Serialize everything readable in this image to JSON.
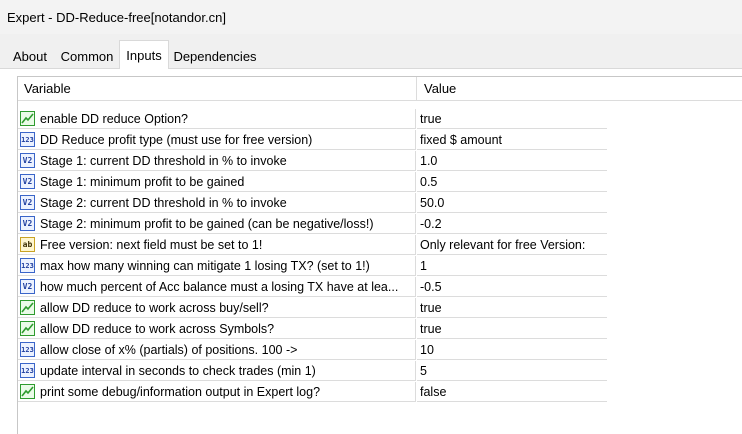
{
  "window": {
    "title": "Expert - DD-Reduce-free[notandor.cn]"
  },
  "tabs": [
    {
      "label": "About"
    },
    {
      "label": "Common"
    },
    {
      "label": "Inputs"
    },
    {
      "label": "Dependencies"
    }
  ],
  "table": {
    "headers": {
      "variable": "Variable",
      "value": "Value"
    },
    "rows": [
      {
        "type": "bool",
        "icon": "boolean-icon",
        "name": "enable DD reduce Option?",
        "value": "true"
      },
      {
        "type": "int",
        "icon": "integer-icon",
        "name": "DD Reduce profit type (must use for free version)",
        "value": "fixed $ amount"
      },
      {
        "type": "double",
        "icon": "double-icon",
        "name": "Stage 1: current DD threshold in % to invoke",
        "value": "1.0"
      },
      {
        "type": "double",
        "icon": "double-icon",
        "name": "Stage 1: minimum profit to be gained",
        "value": "0.5"
      },
      {
        "type": "double",
        "icon": "double-icon",
        "name": "Stage 2: current DD threshold in % to invoke",
        "value": "50.0"
      },
      {
        "type": "double",
        "icon": "double-icon",
        "name": "Stage 2: minimum profit to be gained (can be negative/loss!)",
        "value": "-0.2"
      },
      {
        "type": "string",
        "icon": "string-icon",
        "name": "Free version: next field must be set to 1!",
        "value": "Only relevant for free Version:"
      },
      {
        "type": "int",
        "icon": "integer-icon",
        "name": "max how many winning can mitigate 1 losing TX? (set to 1!)",
        "value": "1"
      },
      {
        "type": "double",
        "icon": "double-icon",
        "name": "how much percent of Acc balance must a losing TX have at lea...",
        "value": "-0.5"
      },
      {
        "type": "bool",
        "icon": "boolean-icon",
        "name": "allow DD reduce to work across buy/sell?",
        "value": "true"
      },
      {
        "type": "bool",
        "icon": "boolean-icon",
        "name": "allow DD reduce to work across Symbols?",
        "value": "true"
      },
      {
        "type": "int",
        "icon": "integer-icon",
        "name": "allow close of x% (partials) of positions. 100 ->",
        "value": "10"
      },
      {
        "type": "int",
        "icon": "integer-icon",
        "name": "update interval in seconds to check trades (min 1)",
        "value": "5"
      },
      {
        "type": "bool",
        "icon": "boolean-icon",
        "name": "print some debug/information output in Expert log?",
        "value": "false"
      }
    ]
  },
  "icon_labels": {
    "int": "123",
    "double": "V2",
    "string": "ab"
  },
  "colors": {
    "bool_green": "#2e9b2e",
    "numeric_blue": "#3a65c9",
    "string_gold": "#c9a325"
  }
}
